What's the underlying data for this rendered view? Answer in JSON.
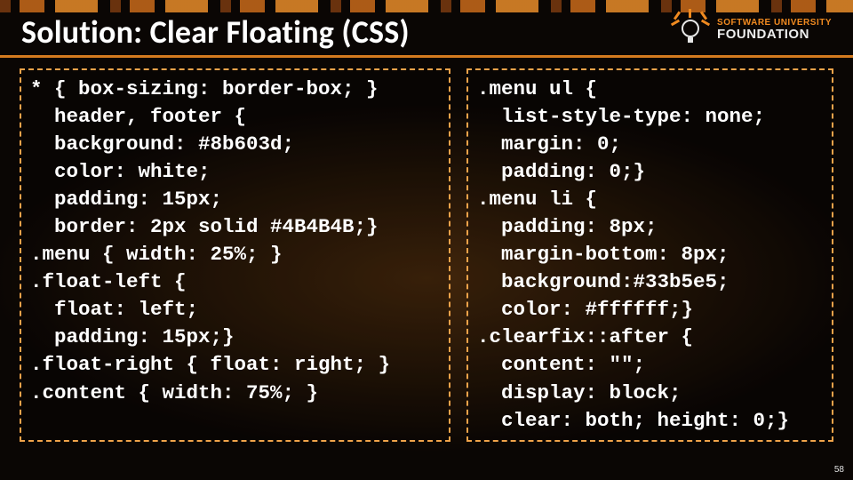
{
  "header": {
    "title": "Solution: Clear Floating (CSS)",
    "logo": {
      "line1": "SOFTWARE UNIVERSITY",
      "line2": "FOUNDATION"
    }
  },
  "code": {
    "left": "* { box-sizing: border-box; }\n  header, footer {\n  background: #8b603d;\n  color: white;\n  padding: 15px;\n  border: 2px solid #4B4B4B;}\n.menu { width: 25%; }\n.float-left {\n  float: left;\n  padding: 15px;}\n.float-right { float: right; }\n.content { width: 75%; }",
    "right": ".menu ul {\n  list-style-type: none;\n  margin: 0;\n  padding: 0;}\n.menu li {\n  padding: 8px;\n  margin-bottom: 8px;\n  background:#33b5e5;\n  color: #ffffff;}\n.clearfix::after {\n  content: \"\";\n  display: block;\n  clear: both; height: 0;}"
  },
  "page_number": "58"
}
